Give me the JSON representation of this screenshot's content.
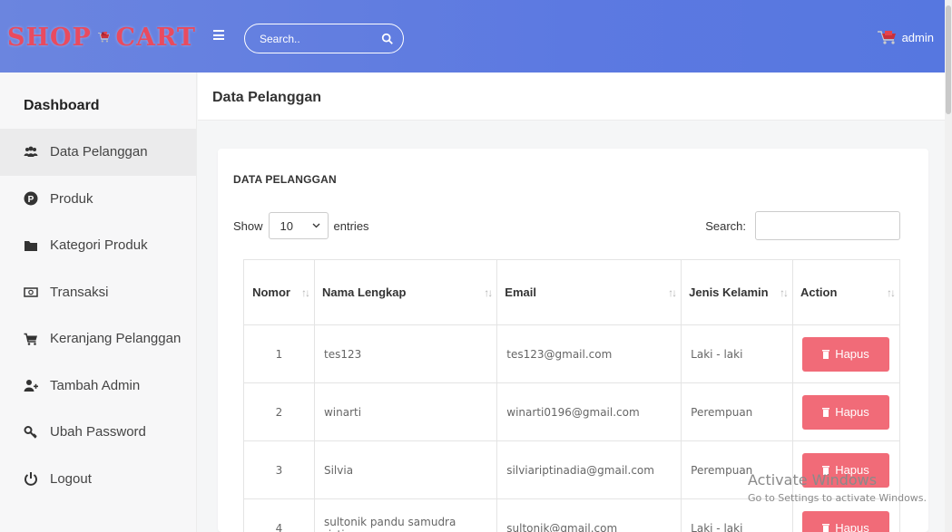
{
  "brand": {
    "left": "SHOP",
    "right": "CART"
  },
  "topbar": {
    "search_placeholder": "Search..",
    "user": "admin"
  },
  "sidebar": {
    "title": "Dashboard",
    "items": [
      {
        "label": "Data Pelanggan",
        "icon": "users-icon",
        "active": true
      },
      {
        "label": "Produk",
        "icon": "product-p-icon"
      },
      {
        "label": "Kategori Produk",
        "icon": "folder-icon"
      },
      {
        "label": "Transaksi",
        "icon": "money-bill-icon"
      },
      {
        "label": "Keranjang Pelanggan",
        "icon": "shopping-cart-icon"
      },
      {
        "label": "Tambah Admin",
        "icon": "user-plus-icon"
      },
      {
        "label": "Ubah Password",
        "icon": "key-icon"
      },
      {
        "label": "Logout",
        "icon": "power-icon"
      }
    ]
  },
  "page": {
    "title": "Data Pelanggan"
  },
  "card": {
    "title": "DATA PELANGGAN",
    "show_label": "Show",
    "entries_value": "10",
    "entries_label": "entries",
    "search_label": "Search:"
  },
  "table": {
    "columns": [
      "Nomor",
      "Nama Lengkap",
      "Email",
      "Jenis Kelamin",
      "Action"
    ],
    "rows": [
      {
        "nomor": "1",
        "nama": "tes123",
        "email": "tes123@gmail.com",
        "jk": "Laki - laki",
        "action": "Hapus"
      },
      {
        "nomor": "2",
        "nama": "winarti",
        "email": "winarti0196@gmail.com",
        "jk": "Perempuan",
        "action": "Hapus"
      },
      {
        "nomor": "3",
        "nama": "Silvia",
        "email": "silviariptinadia@gmail.com",
        "jk": "Perempuan",
        "action": "Hapus"
      },
      {
        "nomor": "4",
        "nama": "sultonik pandu samudra ristian",
        "email": "sultonik@gmail.com",
        "jk": "Laki - laki",
        "action": "Hapus"
      }
    ]
  },
  "watermark": {
    "title": "Activate Windows",
    "subtitle": "Go to Settings to activate Windows."
  },
  "colors": {
    "navbar": "#5c79e1",
    "brand": "#e94b5f",
    "danger_button": "#f16b78"
  }
}
